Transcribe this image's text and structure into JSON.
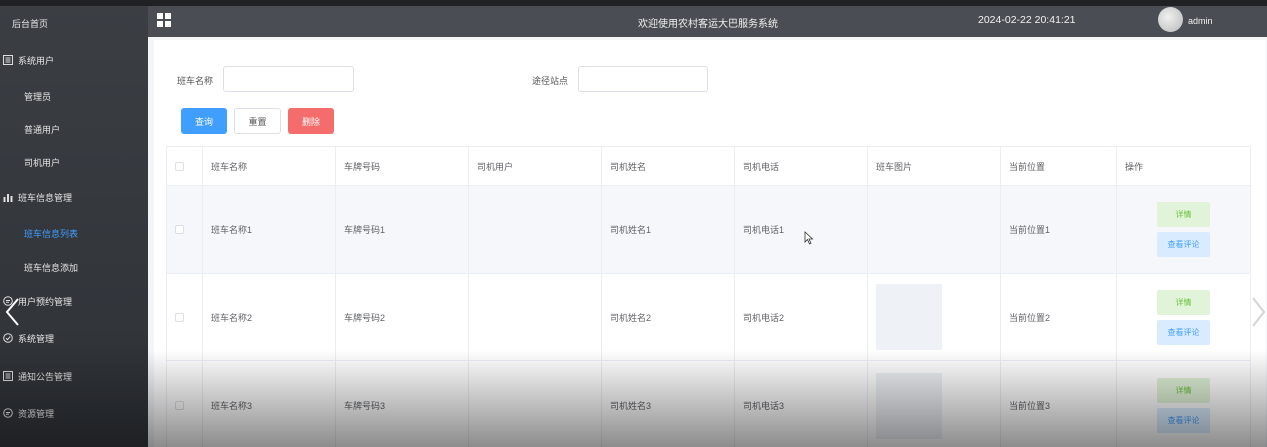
{
  "sidebar": {
    "home": "后台首页",
    "groups": [
      {
        "label": "系统用户",
        "icon": "list-icon",
        "children": [
          "管理员",
          "普通用户",
          "司机用户"
        ]
      },
      {
        "label": "班车信息管理",
        "icon": "bar-chart-icon",
        "children": [
          "班车信息列表",
          "班车信息添加"
        ],
        "active_child": "班车信息列表"
      },
      {
        "label": "用户预约管理",
        "icon": "chat-icon"
      },
      {
        "label": "系统管理",
        "icon": "check-circle-icon"
      },
      {
        "label": "通知公告管理",
        "icon": "list-icon"
      },
      {
        "label": "资源管理",
        "icon": "chat-icon"
      }
    ]
  },
  "header": {
    "title": "欢迎使用农村客运大巴服务系统",
    "datetime": "2024-02-22 20:41:21",
    "username": "admin"
  },
  "search": {
    "name_label": "班车名称",
    "name_value": "",
    "station_label": "途径站点",
    "station_value": "",
    "query_button": "查询",
    "reset_button": "重置",
    "delete_button": "删除"
  },
  "table": {
    "columns": [
      "班车名称",
      "车牌号码",
      "司机用户",
      "司机姓名",
      "司机电话",
      "班车图片",
      "当前位置",
      "操作"
    ],
    "rows": [
      {
        "name": "班车名称1",
        "plate": "车牌号码1",
        "driver_user": "",
        "driver_name": "司机姓名1",
        "driver_phone": "司机电话1",
        "has_image": false,
        "location": "当前位置1"
      },
      {
        "name": "班车名称2",
        "plate": "车牌号码2",
        "driver_user": "",
        "driver_name": "司机姓名2",
        "driver_phone": "司机电话2",
        "has_image": true,
        "location": "当前位置2"
      },
      {
        "name": "班车名称3",
        "plate": "车牌号码3",
        "driver_user": "",
        "driver_name": "司机姓名3",
        "driver_phone": "司机电话3",
        "has_image": true,
        "location": "当前位置3"
      }
    ],
    "actions": {
      "detail": "详情",
      "comments": "查看评论"
    }
  },
  "colors": {
    "sidebar_bg": "#33373c",
    "header_bg": "#4a4e54",
    "primary": "#409eff",
    "danger": "#f56c6c",
    "success_text": "#67c23a"
  }
}
